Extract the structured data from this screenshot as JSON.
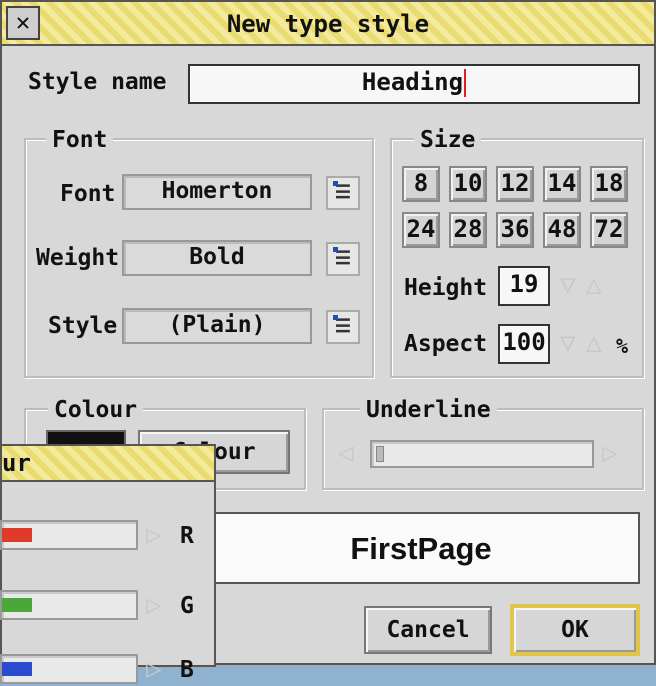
{
  "window": {
    "title": "New type style"
  },
  "style_name": {
    "label": "Style name",
    "value": "Heading"
  },
  "font_group": {
    "title": "Font",
    "font_label": "Font",
    "font_value": "Homerton",
    "weight_label": "Weight",
    "weight_value": "Bold",
    "style_label": "Style",
    "style_value": "(Plain)"
  },
  "size_group": {
    "title": "Size",
    "sizes": [
      "8",
      "10",
      "12",
      "14",
      "18",
      "24",
      "28",
      "36",
      "48",
      "72"
    ],
    "height_label": "Height",
    "height_value": "19",
    "aspect_label": "Aspect",
    "aspect_value": "100",
    "aspect_unit": "%"
  },
  "colour_group": {
    "title": "Colour",
    "button_label": "Colour",
    "swatch_color": "#111111"
  },
  "underline_group": {
    "title": "Underline"
  },
  "preview": {
    "text": "FirstPage"
  },
  "buttons": {
    "cancel": "Cancel",
    "ok": "OK"
  },
  "colour_window": {
    "title": "ur",
    "channels": [
      {
        "label": "R",
        "color": "#e03a2a"
      },
      {
        "label": "G",
        "color": "#4aa83a"
      },
      {
        "label": "B",
        "color": "#2a4ad0"
      }
    ]
  },
  "colors": {
    "titlebar": "#f0e38a",
    "background": "#d8d8d8",
    "ok_highlight": "#e1c64a"
  }
}
